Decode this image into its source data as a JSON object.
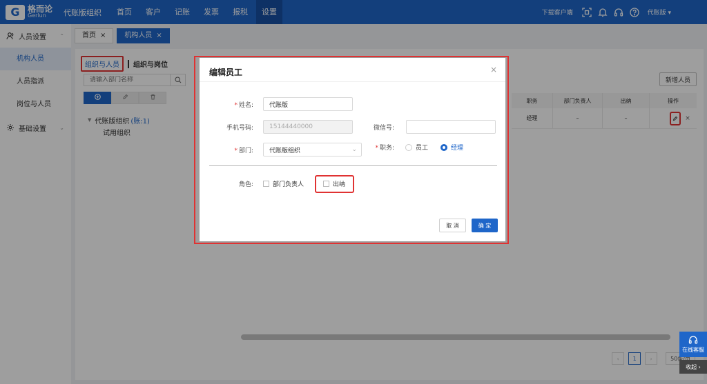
{
  "topbar": {
    "logo_cn": "格而论",
    "logo_en": "Gerlun",
    "org": "代账版组织",
    "nav": [
      "首页",
      "客户",
      "记账",
      "发票",
      "报税",
      "设置"
    ],
    "active_nav": "设置",
    "download": "下载客户端",
    "user": "代账版"
  },
  "sidebar": {
    "group1": "人员设置",
    "items": [
      "机构人员",
      "人员指派",
      "岗位与人员"
    ],
    "group2": "基础设置"
  },
  "tabs": [
    {
      "label": "首页"
    },
    {
      "label": "机构人员"
    }
  ],
  "content": {
    "subtab_active": "组织与人员",
    "subtab_other": "组织与岗位",
    "search_placeholder": "请输入部门名称",
    "tree_root": "代账版组织",
    "tree_root_count": "(账:1)",
    "tree_child": "试用组织",
    "add_button": "新增人员",
    "table_headers": [
      "职务",
      "部门负责人",
      "出纳",
      "操作"
    ],
    "table_row": [
      "经理",
      "–",
      "–"
    ],
    "pager": {
      "current": "1",
      "size": "50条/页"
    }
  },
  "modal": {
    "title": "编辑员工",
    "name_label": "姓名:",
    "name_value": "代账版",
    "phone_label": "手机号码:",
    "phone_value": "15144440000",
    "wechat_label": "微信号:",
    "wechat_value": "",
    "dept_label": "部门:",
    "dept_value": "代账版组织",
    "position_label": "职务:",
    "position_options": [
      "员工",
      "经理"
    ],
    "position_selected": "经理",
    "role_label": "角色:",
    "roles": [
      "部门负责人",
      "出纳"
    ],
    "cancel": "取 消",
    "ok": "确 定"
  },
  "service": {
    "label": "在线客服",
    "collapse": "收起"
  }
}
